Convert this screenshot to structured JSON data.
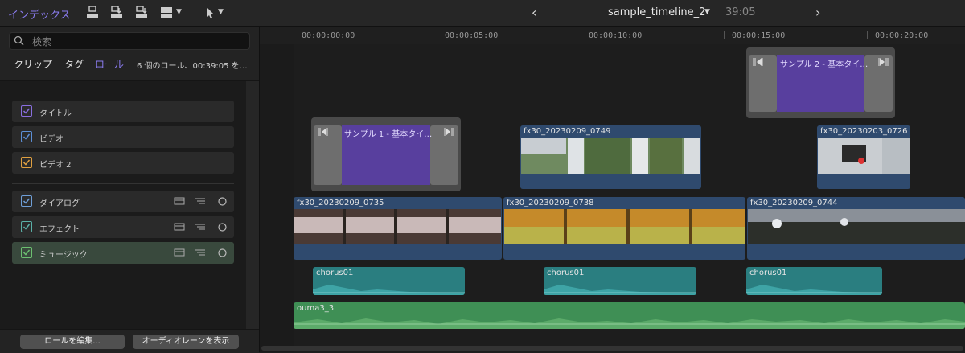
{
  "toolbar": {
    "index_label": "インデックス",
    "prev_icon": "chevron-left-icon",
    "next_icon": "chevron-right-icon",
    "timeline_title": "sample_timeline_2",
    "duration": "39:05"
  },
  "sidebar": {
    "search_placeholder": "検索",
    "tabs": [
      {
        "label": "クリップ"
      },
      {
        "label": "タグ"
      },
      {
        "label": "ロール"
      }
    ],
    "active_tab": "ロール",
    "summary": "6 個のロール、00:39:05 を…",
    "roles": [
      {
        "label": "タイトル",
        "color": "#8a6fe0",
        "checked": true
      },
      {
        "label": "ビデオ",
        "color": "#5c8fd6",
        "checked": true
      },
      {
        "label": "ビデオ 2",
        "color": "#e0a040",
        "checked": true
      },
      {
        "label": "ダイアログ",
        "color": "#6f9fd8",
        "checked": true
      },
      {
        "label": "エフェクト",
        "color": "#5ab0a8",
        "checked": true
      },
      {
        "label": "ミュージック",
        "color": "#6cc070",
        "checked": true
      }
    ],
    "buttons": {
      "edit_roles": "ロールを編集...",
      "show_audio_lanes": "オーディオレーンを表示"
    }
  },
  "timeline": {
    "timecodes": [
      "00:00:00:00",
      "00:00:05:00",
      "00:00:10:00",
      "00:00:15:00",
      "00:00:20:00"
    ],
    "titles": [
      {
        "name": "サンプル 1 - 基本タイ…"
      },
      {
        "name": "サンプル 2 - 基本タイ…"
      }
    ],
    "connected_video": [
      {
        "name": "fx30_20230209_0749"
      },
      {
        "name": "fx30_20230203_0726"
      }
    ],
    "primary": [
      {
        "name": "fx30_20230209_0735"
      },
      {
        "name": "fx30_20230209_0738"
      },
      {
        "name": "fx30_20230209_0744"
      }
    ],
    "effects": [
      {
        "name": "chorus01"
      },
      {
        "name": "chorus01"
      },
      {
        "name": "chorus01"
      }
    ],
    "music": {
      "name": "ouma3_3"
    },
    "colors": {
      "title": "#583f9e",
      "video": "#2f4a6e",
      "effect": "#2a7e80",
      "music": "#3f8f55"
    }
  }
}
